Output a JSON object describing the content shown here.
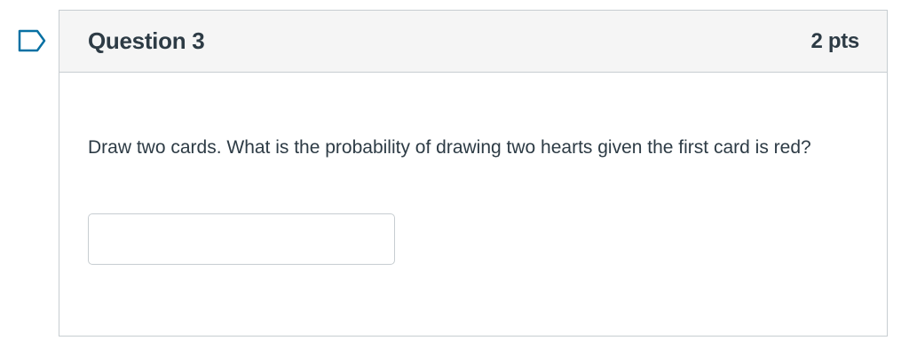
{
  "question": {
    "title": "Question 3",
    "points": "2 pts",
    "text": "Draw two cards. What is the probability of drawing two hearts given the first card is red?",
    "answer": {
      "value": "",
      "placeholder": ""
    }
  },
  "icons": {
    "flag": "flag-question-icon"
  },
  "colors": {
    "flag_stroke": "#0770A3",
    "text": "#2D3B45",
    "header_bg": "#F5F5F5",
    "border": "#C7CDD1"
  }
}
